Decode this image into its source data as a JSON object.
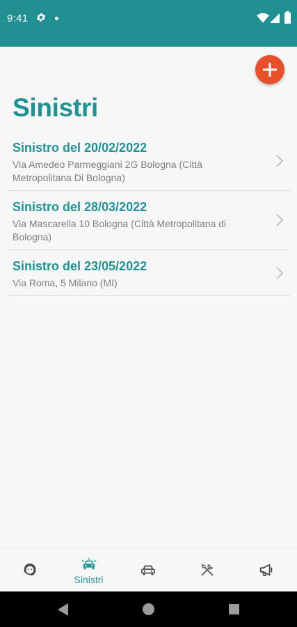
{
  "status_bar": {
    "time": "9:41"
  },
  "page": {
    "title": "Sinistri"
  },
  "claims": [
    {
      "title": "Sinistro del 20/02/2022",
      "address": "Via Amedeo Parmeggiani 2G Bologna (Città Metropolitana Di Bologna)"
    },
    {
      "title": "Sinistro del 28/03/2022",
      "address": "Via Mascarella 10 Bologna (Città Metropolitana di Bologna)"
    },
    {
      "title": "Sinistro del 23/05/2022",
      "address": "Via Roma, 5 Milano (MI)"
    }
  ],
  "bottom_nav": {
    "tabs": [
      {
        "icon": "support-agent-icon",
        "label": ""
      },
      {
        "icon": "car-crash-icon",
        "label": "Sinistri",
        "active": true
      },
      {
        "icon": "car-icon",
        "label": ""
      },
      {
        "icon": "tools-icon",
        "label": ""
      },
      {
        "icon": "megaphone-icon",
        "label": ""
      }
    ]
  },
  "colors": {
    "primary": "#1e9396",
    "status_bar": "#1f8f91",
    "fab": "#e8502a",
    "text_secondary": "#7f7f7f",
    "inactive_icon": "#444444"
  }
}
